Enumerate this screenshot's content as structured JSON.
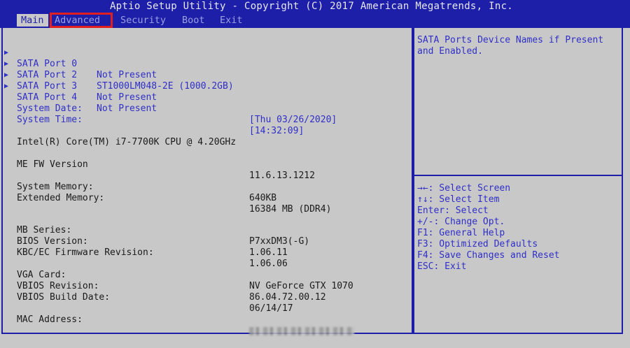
{
  "title": "Aptio Setup Utility - Copyright (C) 2017 American Megatrends, Inc.",
  "tabs": [
    {
      "label": "Main",
      "active": true
    },
    {
      "label": "Advanced",
      "active": false,
      "highlighted": true
    },
    {
      "label": "Security",
      "active": false
    },
    {
      "label": "Boot",
      "active": false
    },
    {
      "label": "Exit",
      "active": false
    }
  ],
  "sata_ports": [
    {
      "label": "SATA Port 0",
      "value": "Not Present"
    },
    {
      "label": "SATA Port 2",
      "value": "ST1000LM048-2E (1000.2GB)"
    },
    {
      "label": "SATA Port 3",
      "value": "Not Present"
    },
    {
      "label": "SATA Port 4",
      "value": "Not Present"
    }
  ],
  "system_date": {
    "label": "System Date:",
    "value": "[Thu 03/26/2020]"
  },
  "system_time": {
    "label": "System Time:",
    "value": "[14:32:09]"
  },
  "cpu": "Intel(R) Core(TM) i7-7700K CPU @ 4.20GHz",
  "me_fw": {
    "label": "ME FW Version",
    "value": "11.6.13.1212"
  },
  "system_memory": {
    "label": "System Memory:",
    "value": "640KB"
  },
  "extended_memory": {
    "label": "Extended Memory:",
    "value": "16384 MB (DDR4)"
  },
  "mb_series": {
    "label": "MB Series:",
    "value": "P7xxDM3(-G)"
  },
  "bios_version": {
    "label": "BIOS Version:",
    "value": "1.06.11"
  },
  "kbc_ec": {
    "label": "KBC/EC Firmware Revision:",
    "value": "1.06.06"
  },
  "vga_card": {
    "label": "VGA Card:",
    "value": "NV GeForce GTX 1070"
  },
  "vbios_revision": {
    "label": "VBIOS Revision:",
    "value": "86.04.72.00.12"
  },
  "vbios_date": {
    "label": "VBIOS Build Date:",
    "value": "06/14/17"
  },
  "mac_address": {
    "label": "MAC Address:"
  },
  "help_text": "SATA Ports Device Names if Present and Enabled.",
  "keys": [
    "→←: Select Screen",
    "↑↓: Select Item",
    "Enter: Select",
    "+/-: Change Opt.",
    "F1: General Help",
    "F3: Optimized Defaults",
    "F4: Save Changes and Reset",
    "ESC: Exit"
  ],
  "colors": {
    "accent": "#1d1fa8",
    "background": "#c8c8c8",
    "highlight": "#e02020",
    "link_text": "#2f2fc8"
  }
}
